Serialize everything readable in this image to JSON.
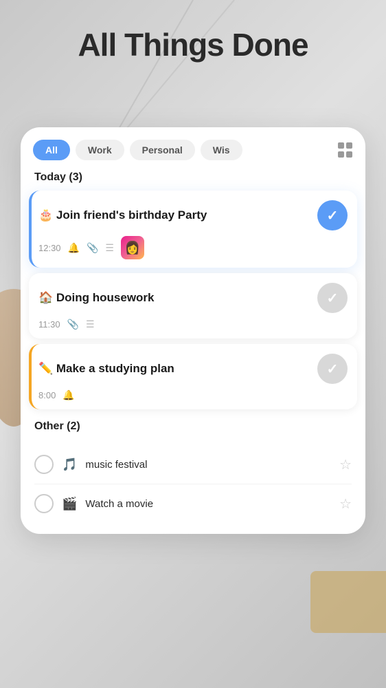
{
  "app": {
    "title": "All Things Done"
  },
  "filters": {
    "items": [
      {
        "label": "All",
        "active": true
      },
      {
        "label": "Work",
        "active": false
      },
      {
        "label": "Personal",
        "active": false
      },
      {
        "label": "Wis",
        "active": false
      }
    ]
  },
  "today_section": {
    "label": "Today (3)",
    "tasks": [
      {
        "id": 1,
        "emoji": "🎂",
        "title": "Join friend's birthday Party",
        "time": "12:30",
        "has_bell": true,
        "has_attachment": true,
        "has_list": true,
        "has_thumb": true,
        "done": true,
        "highlighted": true,
        "yellow": false
      },
      {
        "id": 2,
        "emoji": "🏠",
        "title": "Doing housework",
        "time": "11:30",
        "has_bell": false,
        "has_attachment": true,
        "has_list": true,
        "has_thumb": false,
        "done": false,
        "highlighted": false,
        "yellow": false
      },
      {
        "id": 3,
        "emoji": "✏️",
        "title": "Make a studying plan",
        "time": "8:00",
        "has_bell": true,
        "has_attachment": false,
        "has_list": false,
        "has_thumb": false,
        "done": false,
        "highlighted": false,
        "yellow": true
      }
    ]
  },
  "other_section": {
    "label": "Other (2)",
    "tasks": [
      {
        "id": 4,
        "emoji": "🎵",
        "title": "music festival",
        "starred": false
      },
      {
        "id": 5,
        "emoji": "🎬",
        "title": "Watch a movie",
        "starred": false
      }
    ]
  }
}
